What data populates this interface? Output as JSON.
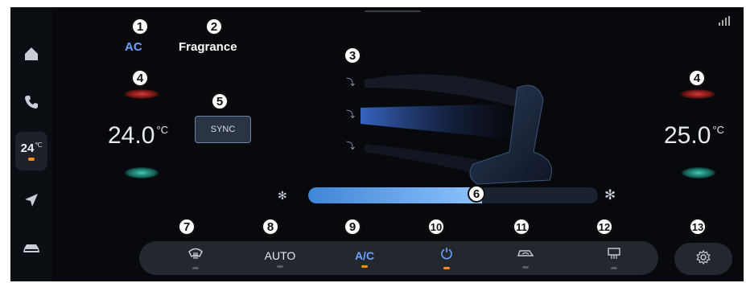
{
  "tabs": [
    {
      "label": "AC",
      "active": true
    },
    {
      "label": "Fragrance",
      "active": false
    }
  ],
  "sidebar": {
    "items": [
      {
        "name": "home",
        "icon": "home-icon"
      },
      {
        "name": "phone",
        "icon": "phone-icon"
      },
      {
        "name": "climate",
        "temp": "24",
        "unit": "℃",
        "active": true
      },
      {
        "name": "navigation",
        "icon": "navigation-arrow-icon"
      },
      {
        "name": "vehicle",
        "icon": "car-icon"
      }
    ]
  },
  "left_zone": {
    "temp": "24.0",
    "unit": "°C"
  },
  "right_zone": {
    "temp": "25.0",
    "unit": "°C"
  },
  "sync_label": "SYNC",
  "bottom_bar": {
    "items": [
      {
        "name": "front-defrost",
        "icon": "front-defrost-icon",
        "label": "",
        "active": false
      },
      {
        "name": "auto",
        "label": "AUTO",
        "active": false
      },
      {
        "name": "ac",
        "label": "A/C",
        "active": true
      },
      {
        "name": "power",
        "icon": "power-icon",
        "label": "",
        "active": true
      },
      {
        "name": "recirculation",
        "icon": "recirculation-icon",
        "label": "",
        "active": false
      },
      {
        "name": "rear-defrost",
        "icon": "rear-defrost-icon",
        "label": "",
        "active": false
      }
    ]
  },
  "fan_level": 0.6,
  "callouts": [
    "1",
    "2",
    "3",
    "4",
    "4",
    "5",
    "6",
    "7",
    "8",
    "9",
    "10",
    "11",
    "12",
    "13"
  ],
  "colors": {
    "accent": "#6fa0ff",
    "on_indicator": "#ff8a1f",
    "heat": "#d43b3b",
    "cool": "#46c7b5",
    "background": "#07090c"
  }
}
